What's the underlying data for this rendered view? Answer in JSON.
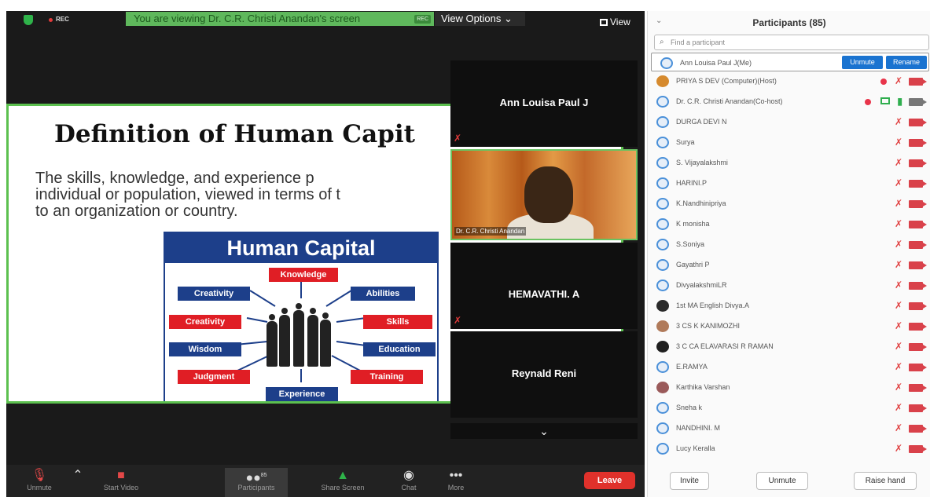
{
  "topbar": {
    "rec_label": "REC",
    "viewing_text": "You are viewing Dr. C.R. Christi Anandan's screen",
    "viewing_rec": "REC",
    "view_options": "View Options",
    "view_label": "View"
  },
  "slide": {
    "title": "Definition of Human Capit",
    "body_line1": "The  skills,  knowledge,  and  experience  p",
    "body_line2": "individual or population, viewed in terms of t",
    "body_line3": "to an organization or country.",
    "diagram_title": "Human Capital",
    "boxes": {
      "knowledge": "Knowledge",
      "creativity_blue": "Creativity",
      "abilities": "Abilities",
      "creativity_red": "Creativity",
      "skills": "Skills",
      "wisdom": "Wisdom",
      "education": "Education",
      "judgment": "Judgment",
      "training": "Training",
      "experience": "Experience"
    }
  },
  "strip": {
    "tile1_name": "Ann Louisa Paul J",
    "video_name": "Dr. C.R. Christi Anandan",
    "tile3_name": "HEMAVATHI. A",
    "tile4_name": "Reynald Reni"
  },
  "toolbar": {
    "unmute": "Unmute",
    "start_video": "Start Video",
    "participants": "Participants",
    "participants_count": "85",
    "share_screen": "Share Screen",
    "chat": "Chat",
    "more": "More",
    "leave": "Leave"
  },
  "panel": {
    "title": "Participants (85)",
    "search_placeholder": "Find a participant",
    "unmute_btn": "Unmute",
    "rename_btn": "Rename",
    "participants": [
      "Ann Louisa Paul J(Me)",
      "PRIYA S DEV (Computer)(Host)",
      "Dr. C.R. Christi Anandan(Co-host)",
      "DURGA DEVI N",
      "Surya",
      "S. Vijayalakshmi",
      "HARINI.P",
      "K.Nandhinipriya",
      "K monisha",
      "S.Soniya",
      "Gayathri P",
      "DivyalakshmiLR",
      "1st MA English Divya.A",
      "3 CS K KANIMOZHI",
      "3 C CA ELAVARASI R RAMAN",
      "E.RAMYA",
      "Karthika Varshan",
      "Sneha k",
      "NANDHINI. M",
      "Lucy Keralla"
    ],
    "invite": "Invite",
    "unmute_me": "Unmute",
    "raise_hand": "Raise hand"
  },
  "colors": {
    "accent_green": "#5cc04f",
    "leave_red": "#e0312b",
    "button_blue": "#1a73d0",
    "diagram_blue": "#1d3f8a",
    "diagram_red": "#e01e25"
  }
}
